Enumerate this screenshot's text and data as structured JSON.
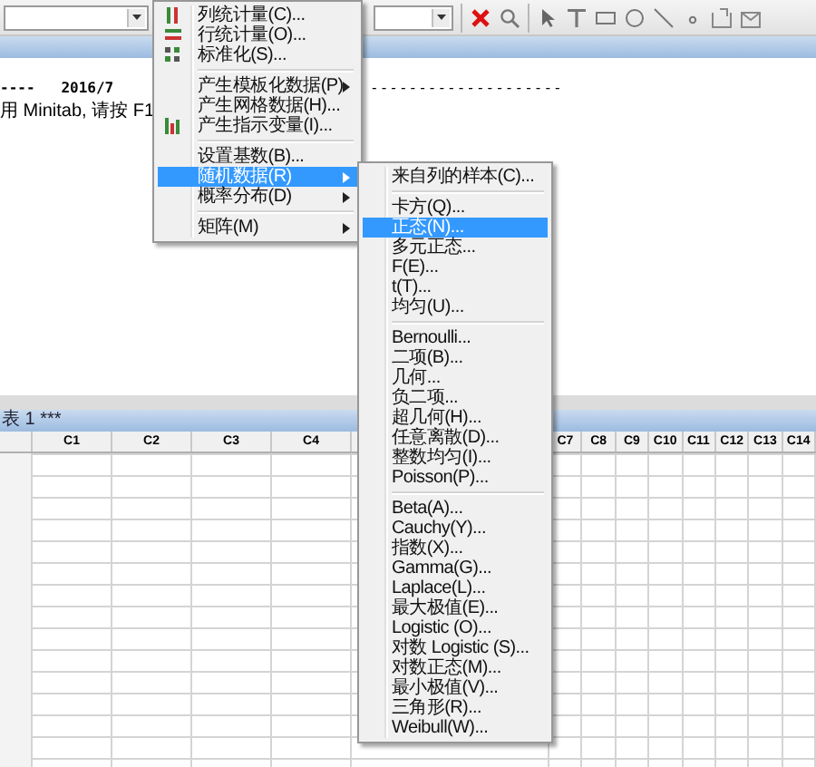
{
  "toolbar": {
    "combos": [
      {
        "kind": "combo"
      },
      {
        "kind": "combo"
      }
    ]
  },
  "session": {
    "lines": [
      {
        "text": "----   2016/7",
        "continuation": "--------------------"
      },
      {
        "text": "用 Minitab, 请按 F1"
      }
    ]
  },
  "worksheet": {
    "title": "表 1 ***",
    "columns": [
      "C1",
      "C2",
      "C3",
      "C4",
      "C7",
      "C8",
      "C9",
      "C10",
      "C11",
      "C12",
      "C13",
      "C14"
    ]
  },
  "menu": {
    "items": [
      {
        "kind": "item",
        "label": "列统计量(C)...",
        "selected": false
      },
      {
        "kind": "item",
        "label": "行统计量(O)...",
        "selected": false
      },
      {
        "kind": "item",
        "label": "标准化(S)...",
        "selected": false
      },
      {
        "kind": "separator"
      },
      {
        "kind": "submenu",
        "label": "产生模板化数据(P)",
        "selected": false
      },
      {
        "kind": "item",
        "label": "产生网格数据(H)...",
        "selected": false
      },
      {
        "kind": "item",
        "label": "产生指示变量(I)...",
        "selected": false
      },
      {
        "kind": "separator"
      },
      {
        "kind": "item",
        "label": "设置基数(B)...",
        "selected": false
      },
      {
        "kind": "submenu",
        "label": "随机数据(R)",
        "selected": true
      },
      {
        "kind": "submenu",
        "label": "概率分布(D)",
        "selected": false
      },
      {
        "kind": "separator"
      },
      {
        "kind": "submenu",
        "label": "矩阵(M)",
        "selected": false
      }
    ]
  },
  "submenu": {
    "items": [
      {
        "kind": "item",
        "label": "来自列的样本(C)...",
        "selected": false
      },
      {
        "kind": "separator"
      },
      {
        "kind": "item",
        "label": "卡方(Q)...",
        "selected": false
      },
      {
        "kind": "item",
        "label": "正态(N)...",
        "selected": true
      },
      {
        "kind": "item",
        "label": "多元正态...",
        "selected": false
      },
      {
        "kind": "item",
        "label": "F(E)...",
        "selected": false
      },
      {
        "kind": "item",
        "label": "t(T)...",
        "selected": false
      },
      {
        "kind": "item",
        "label": "均匀(U)...",
        "selected": false
      },
      {
        "kind": "separator"
      },
      {
        "kind": "item",
        "label": "Bernoulli...",
        "selected": false
      },
      {
        "kind": "item",
        "label": "二项(B)...",
        "selected": false
      },
      {
        "kind": "item",
        "label": "几何...",
        "selected": false
      },
      {
        "kind": "item",
        "label": "负二项...",
        "selected": false
      },
      {
        "kind": "item",
        "label": "超几何(H)...",
        "selected": false
      },
      {
        "kind": "item",
        "label": "任意离散(D)...",
        "selected": false
      },
      {
        "kind": "item",
        "label": "整数均匀(I)...",
        "selected": false
      },
      {
        "kind": "item",
        "label": "Poisson(P)...",
        "selected": false
      },
      {
        "kind": "separator"
      },
      {
        "kind": "item",
        "label": "Beta(A)...",
        "selected": false
      },
      {
        "kind": "item",
        "label": "Cauchy(Y)...",
        "selected": false
      },
      {
        "kind": "item",
        "label": "指数(X)...",
        "selected": false
      },
      {
        "kind": "item",
        "label": "Gamma(G)...",
        "selected": false
      },
      {
        "kind": "item",
        "label": "Laplace(L)...",
        "selected": false
      },
      {
        "kind": "item",
        "label": "最大极值(E)...",
        "selected": false
      },
      {
        "kind": "item",
        "label": "Logistic (O)...",
        "selected": false
      },
      {
        "kind": "item",
        "label": "对数 Logistic (S)...",
        "selected": false
      },
      {
        "kind": "item",
        "label": "对数正态(M)...",
        "selected": false
      },
      {
        "kind": "item",
        "label": "最小极值(V)...",
        "selected": false
      },
      {
        "kind": "item",
        "label": "三角形(R)...",
        "selected": false
      },
      {
        "kind": "item",
        "label": "Weibull(W)...",
        "selected": false
      }
    ]
  }
}
